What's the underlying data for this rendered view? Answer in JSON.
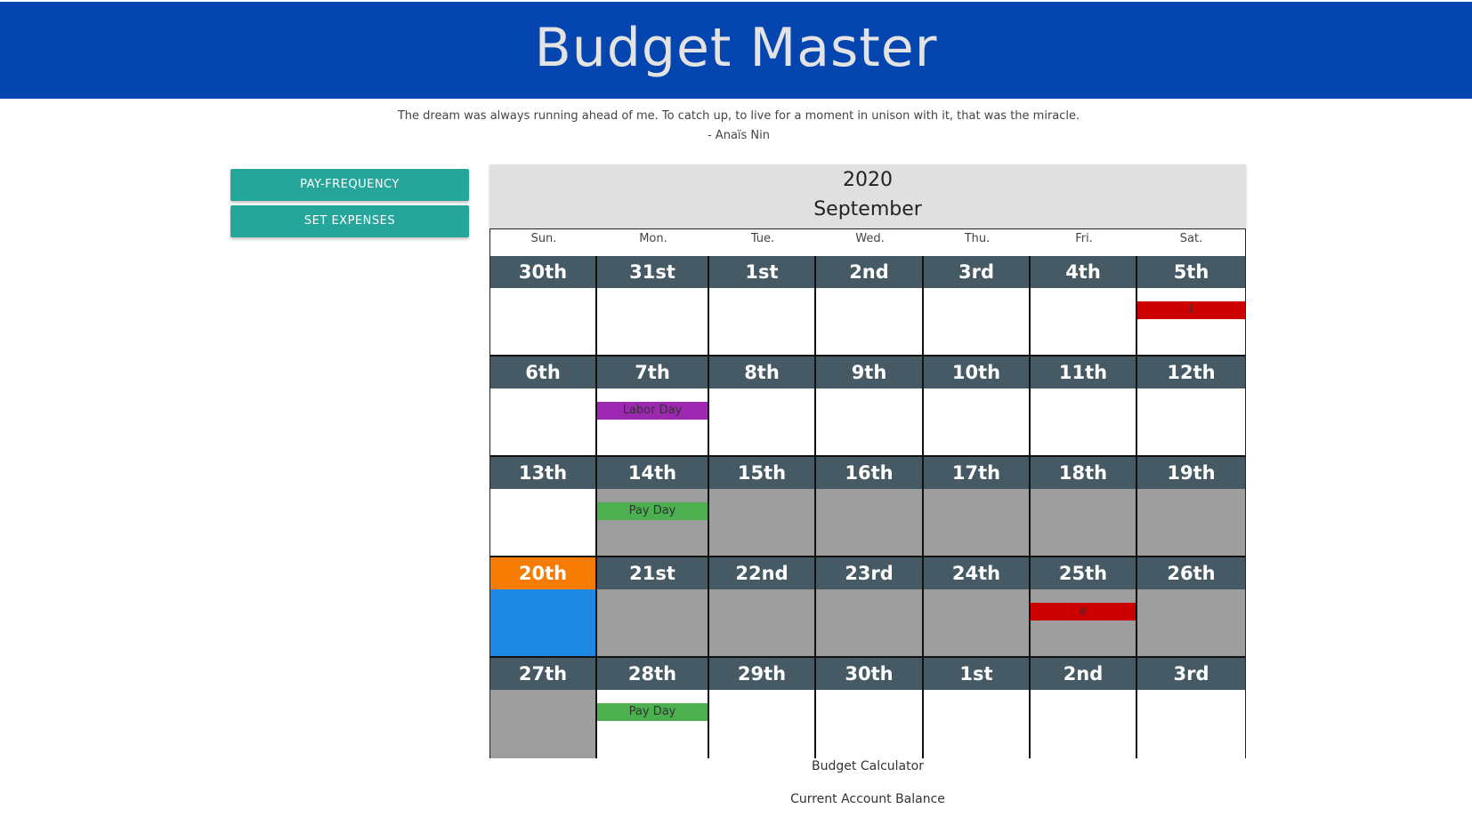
{
  "app": {
    "title": "Budget Master"
  },
  "quote": {
    "text": "The dream was always running ahead of me. To catch up, to live for a moment in unison with it, that was the miracle.",
    "author": "- Anaïs Nin"
  },
  "sidebar": {
    "pay_frequency_label": "PAY-FREQUENCY",
    "set_expenses_label": "SET EXPENSES"
  },
  "calendar": {
    "year": "2020",
    "month": "September",
    "weekdays": [
      "Sun.",
      "Mon.",
      "Tue.",
      "Wed.",
      "Thu.",
      "Fri.",
      "Sat."
    ],
    "weeks": [
      [
        {
          "label": "30th",
          "body": "white"
        },
        {
          "label": "31st",
          "body": "white"
        },
        {
          "label": "1st",
          "body": "white"
        },
        {
          "label": "2nd",
          "body": "white"
        },
        {
          "label": "3rd",
          "body": "white"
        },
        {
          "label": "4th",
          "body": "white"
        },
        {
          "label": "5th",
          "body": "white",
          "event": {
            "text": "i",
            "color": "#cc0000"
          }
        }
      ],
      [
        {
          "label": "6th",
          "body": "white"
        },
        {
          "label": "7th",
          "body": "white",
          "event": {
            "text": "Labor Day",
            "color": "#9c27b0"
          }
        },
        {
          "label": "8th",
          "body": "white"
        },
        {
          "label": "9th",
          "body": "white"
        },
        {
          "label": "10th",
          "body": "white"
        },
        {
          "label": "11th",
          "body": "white"
        },
        {
          "label": "12th",
          "body": "white"
        }
      ],
      [
        {
          "label": "13th",
          "body": "white"
        },
        {
          "label": "14th",
          "body": "grey",
          "event": {
            "text": "Pay Day",
            "color": "#4caf50"
          }
        },
        {
          "label": "15th",
          "body": "grey"
        },
        {
          "label": "16th",
          "body": "grey"
        },
        {
          "label": "17th",
          "body": "grey"
        },
        {
          "label": "18th",
          "body": "grey"
        },
        {
          "label": "19th",
          "body": "grey"
        }
      ],
      [
        {
          "label": "20th",
          "body": "blue",
          "today": true
        },
        {
          "label": "21st",
          "body": "grey"
        },
        {
          "label": "22nd",
          "body": "grey"
        },
        {
          "label": "23rd",
          "body": "grey"
        },
        {
          "label": "24th",
          "body": "grey"
        },
        {
          "label": "25th",
          "body": "grey",
          "event": {
            "text": "a",
            "color": "#cc0000"
          }
        },
        {
          "label": "26th",
          "body": "grey"
        }
      ],
      [
        {
          "label": "27th",
          "body": "grey"
        },
        {
          "label": "28th",
          "body": "white",
          "event": {
            "text": "Pay Day",
            "color": "#4caf50"
          }
        },
        {
          "label": "29th",
          "body": "white"
        },
        {
          "label": "30th",
          "body": "white"
        },
        {
          "label": "1st",
          "body": "white"
        },
        {
          "label": "2nd",
          "body": "white"
        },
        {
          "label": "3rd",
          "body": "white"
        }
      ]
    ]
  },
  "footer": {
    "budget_calculator": "Budget Calculator",
    "current_balance": "Current Account Balance"
  }
}
